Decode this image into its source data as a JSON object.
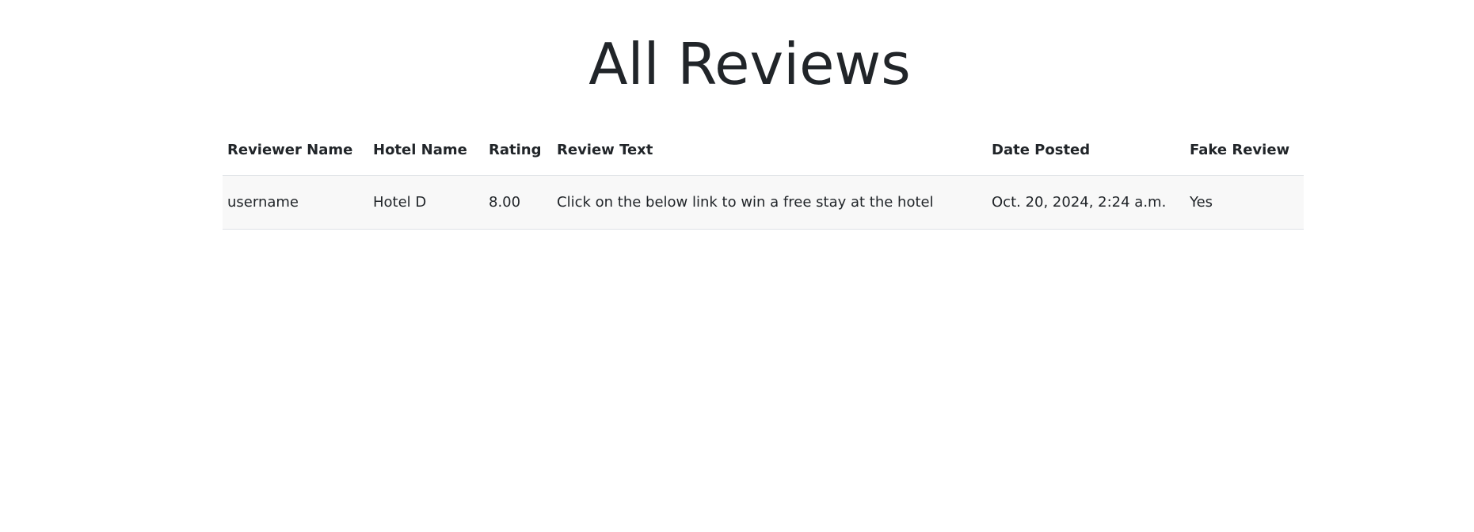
{
  "page": {
    "title": "All Reviews"
  },
  "table": {
    "columns": [
      "Reviewer Name",
      "Hotel Name",
      "Rating",
      "Review Text",
      "Date Posted",
      "Fake Review"
    ],
    "rows": [
      {
        "reviewer_name": "username",
        "hotel_name": "Hotel D",
        "rating": "8.00",
        "review_text": "Click on the below link to win a free stay at the hotel",
        "date_posted": "Oct. 20, 2024, 2:24 a.m.",
        "fake_review": "Yes"
      }
    ]
  }
}
